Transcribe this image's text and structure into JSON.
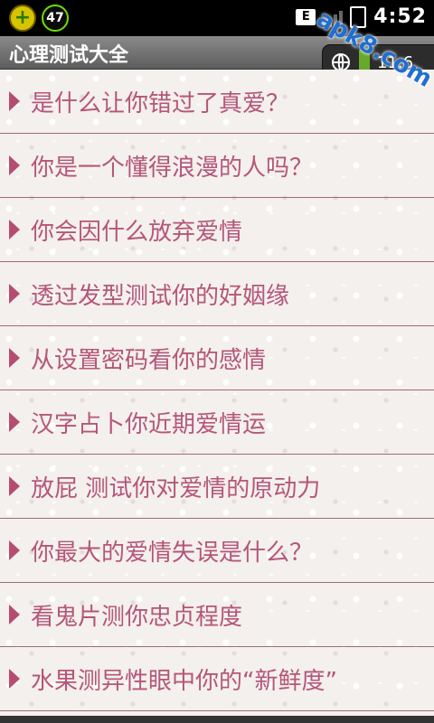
{
  "status_bar": {
    "plus_icon": "plus-icon",
    "notification_count": "47",
    "network_type": "E",
    "time": "4:52",
    "colors": {
      "plus_badge": "#d7c400",
      "count_ring": "#6ddf00"
    }
  },
  "app": {
    "title": "心理测试大全",
    "traffic_widget_text": "11.6"
  },
  "watermark": "apk8.com",
  "list": {
    "items": [
      "是什么让你错过了真爱？",
      "你是一个懂得浪漫的人吗？",
      "你会因什么放弃爱情",
      "透过发型测试你的好姻缘",
      "从设置密码看你的感情",
      "汉字占卜你近期爱情运",
      "放屁 测试你对爱情的原动力",
      "你最大的爱情失误是什么？",
      "看鬼片测你忠贞程度",
      "水果测异性眼中你的“新鲜度”"
    ],
    "colors": {
      "text": "#b5567a",
      "divider": "#a06a79"
    }
  }
}
